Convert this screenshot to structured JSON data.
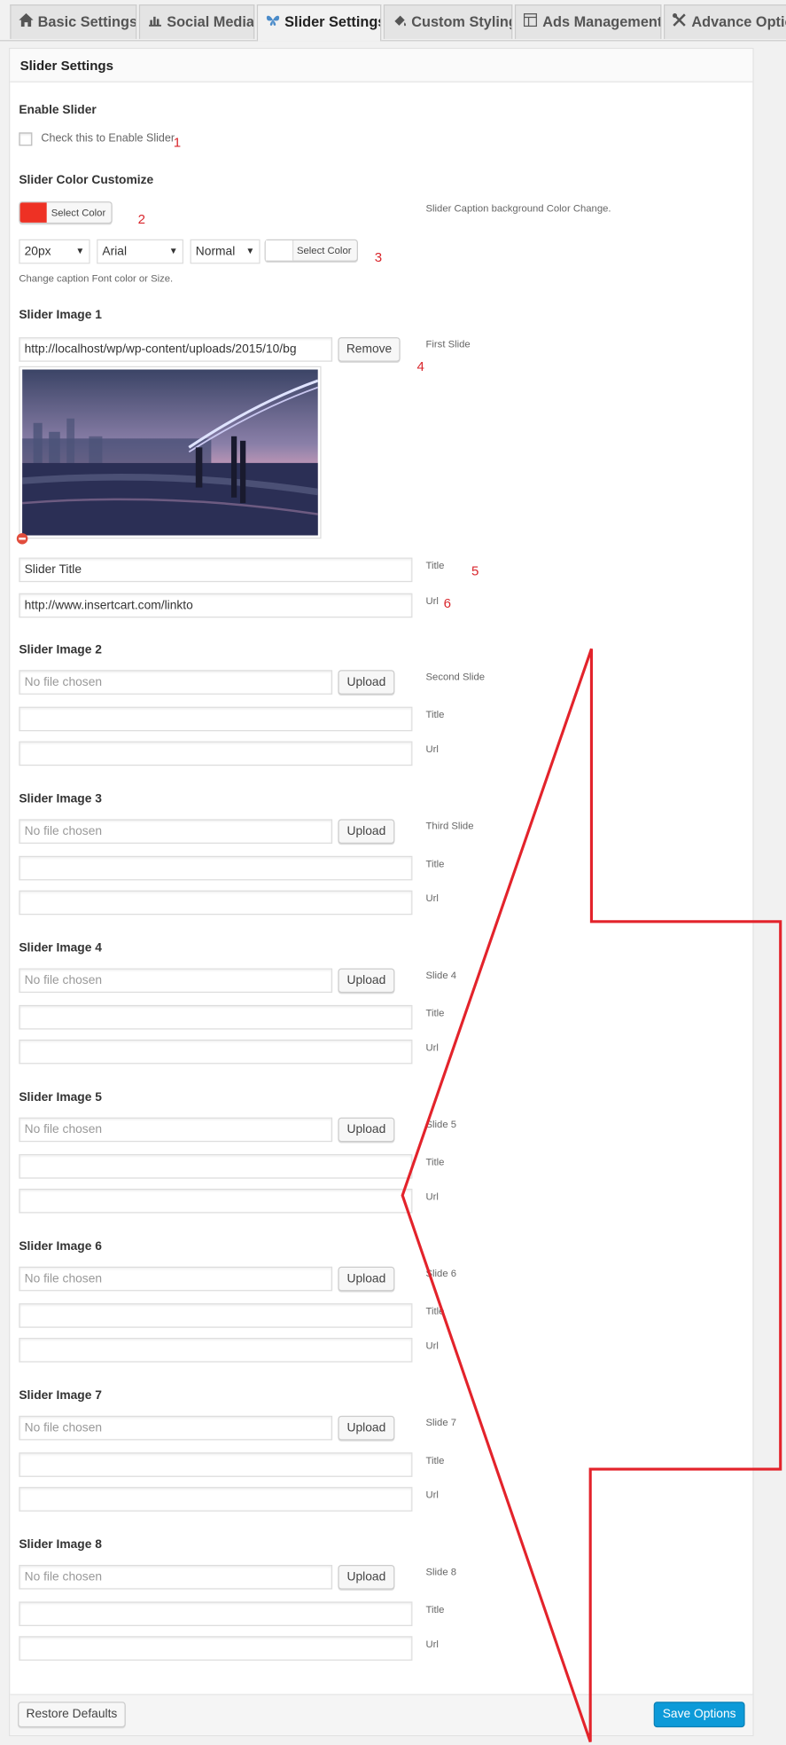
{
  "tabs": [
    {
      "label": "Basic Settings",
      "icon": "home-icon"
    },
    {
      "label": "Social Media",
      "icon": "chart-icon"
    },
    {
      "label": "Slider Settings",
      "icon": "butterfly-icon",
      "active": true
    },
    {
      "label": "Custom Styling",
      "icon": "paint-drop-icon"
    },
    {
      "label": "Ads Management",
      "icon": "layout-icon"
    },
    {
      "label": "Advance Option",
      "icon": "tools-icon"
    }
  ],
  "panel": {
    "title": "Slider Settings",
    "enable": {
      "heading": "Enable Slider",
      "checkbox_label": "Check this to Enable Slider",
      "checked": false,
      "annotation": "1"
    },
    "color": {
      "heading": "Slider Color Customize",
      "swatch_color": "#ee3124",
      "select_color_label": "Select Color",
      "annotation_2": "2",
      "caption_bg_note": "Slider Caption background Color Change.",
      "font_size": "20px",
      "font_family": "Arial",
      "font_weight": "Normal",
      "font_select_color_label": "Select Color",
      "annotation_3": "3",
      "caption_font_note": "Change caption Font color or Size."
    },
    "slide1": {
      "heading": "Slider Image 1",
      "url_value": "http://localhost/wp/wp-content/uploads/2015/10/bg",
      "remove_label": "Remove",
      "side_label": "First Slide",
      "annotation_4": "4",
      "title_value": "Slider Title",
      "title_label": "Title",
      "annotation_5": "5",
      "link_value": "http://www.insertcart.com/linkto",
      "url_label": "Url",
      "annotation_6": "6"
    },
    "slides": [
      {
        "heading": "Slider Image 2",
        "placeholder": "No file chosen",
        "upload": "Upload",
        "side_label": "Second Slide",
        "title_label": "Title",
        "url_label": "Url"
      },
      {
        "heading": "Slider Image 3",
        "placeholder": "No file chosen",
        "upload": "Upload",
        "side_label": "Third Slide",
        "title_label": "Title",
        "url_label": "Url"
      },
      {
        "heading": "Slider Image 4",
        "placeholder": "No file chosen",
        "upload": "Upload",
        "side_label": "Slide 4",
        "title_label": "Title",
        "url_label": "Url"
      },
      {
        "heading": "Slider Image 5",
        "placeholder": "No file chosen",
        "upload": "Upload",
        "side_label": "Slide 5",
        "title_label": "Title",
        "url_label": "Url"
      },
      {
        "heading": "Slider Image 6",
        "placeholder": "No file chosen",
        "upload": "Upload",
        "side_label": "Slide 6",
        "title_label": "Title",
        "url_label": "Url"
      },
      {
        "heading": "Slider Image 7",
        "placeholder": "No file chosen",
        "upload": "Upload",
        "side_label": "Slide 7",
        "title_label": "Title",
        "url_label": "Url"
      },
      {
        "heading": "Slider Image 8",
        "placeholder": "No file chosen",
        "upload": "Upload",
        "side_label": "Slide 8",
        "title_label": "Title",
        "url_label": "Url"
      }
    ],
    "footer": {
      "restore_label": "Restore Defaults",
      "save_label": "Save Options",
      "save_color": "#0d9ad8"
    }
  },
  "annotation_arrow_color": "#e3232b"
}
